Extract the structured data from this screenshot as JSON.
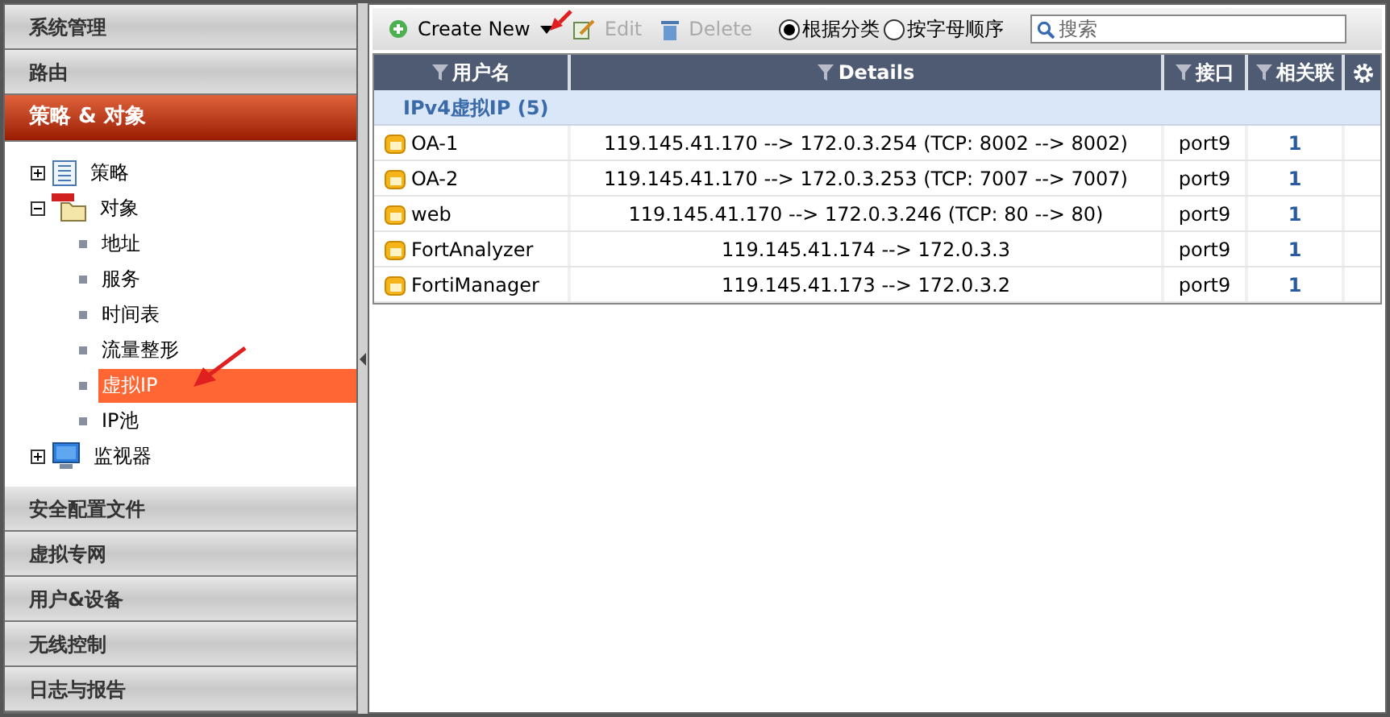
{
  "sidebar": {
    "sections_top": [
      {
        "label": "系统管理",
        "selected": false
      },
      {
        "label": "路由",
        "selected": false
      },
      {
        "label": "策略 & 对象",
        "selected": true
      }
    ],
    "tree": [
      {
        "label": "策略",
        "kind": "list",
        "expanded": false,
        "selected": false
      },
      {
        "label": "对象",
        "kind": "folder",
        "expanded": true,
        "selected": false,
        "children": [
          {
            "label": "地址",
            "selected": false
          },
          {
            "label": "服务",
            "selected": false
          },
          {
            "label": "时间表",
            "selected": false
          },
          {
            "label": "流量整形",
            "selected": false
          },
          {
            "label": "虚拟IP",
            "selected": true
          },
          {
            "label": "IP池",
            "selected": false
          }
        ]
      },
      {
        "label": "监视器",
        "kind": "monitor",
        "expanded": false,
        "selected": false
      }
    ],
    "sections_bottom": [
      {
        "label": "安全配置文件",
        "selected": false
      },
      {
        "label": "虚拟专网",
        "selected": false
      },
      {
        "label": "用户&设备",
        "selected": false
      },
      {
        "label": "无线控制",
        "selected": false
      },
      {
        "label": "日志与报告",
        "selected": false
      }
    ]
  },
  "toolbar": {
    "create": "Create New",
    "edit": {
      "label": "Edit",
      "disabled": true
    },
    "delete": {
      "label": "Delete",
      "disabled": true
    },
    "radios": [
      {
        "label": "根据分类",
        "selected": true
      },
      {
        "label": "按字母顺序",
        "selected": false
      }
    ],
    "search": {
      "placeholder": "搜索"
    }
  },
  "table": {
    "columns": [
      "用户名",
      "Details",
      "接口",
      "相关联"
    ],
    "group": "IPv4虚拟IP (5)",
    "rows": [
      [
        "OA-1",
        "119.145.41.170 --> 172.0.3.254 (TCP: 8002 --> 8002)",
        "port9",
        "1"
      ],
      [
        "OA-2",
        "119.145.41.170 --> 172.0.3.253 (TCP: 7007 --> 7007)",
        "port9",
        "1"
      ],
      [
        "web",
        "119.145.41.170 --> 172.0.3.246 (TCP: 80 --> 80)",
        "port9",
        "1"
      ],
      [
        "FortAnalyzer",
        "119.145.41.174 --> 172.0.3.3",
        "port9",
        "1"
      ],
      [
        "FortiManager",
        "119.145.41.173 --> 172.0.3.2",
        "port9",
        "1"
      ]
    ]
  }
}
